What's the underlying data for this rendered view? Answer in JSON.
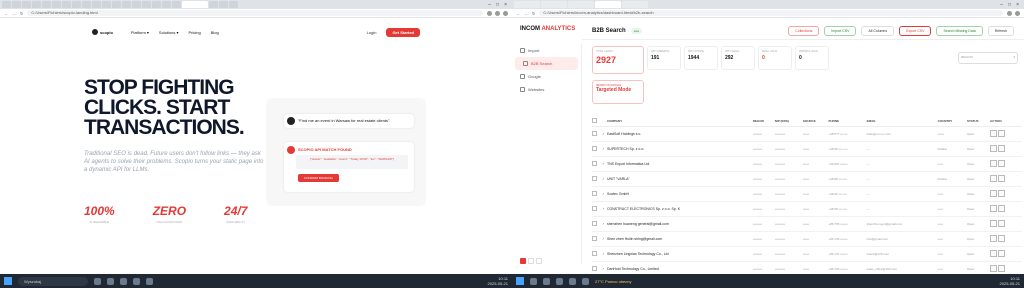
{
  "left": {
    "browser": {
      "url": "C:/Users/Fichiers/scopio-landing.html",
      "window_controls": [
        "–",
        "□",
        "×"
      ]
    },
    "nav": {
      "logo": "scopio",
      "items": [
        "Platform ▾",
        "Solutions ▾",
        "Pricing",
        "Blog"
      ],
      "login": "Login",
      "cta": "Get Started"
    },
    "hero": {
      "title_l1": "STOP FIGHTING",
      "title_l2": "CLICKS. START",
      "title_l3": "TRANSACTIONS.",
      "body": "Traditional SEO is dead. Future users don't follow links — they ask AI agents to solve their problems. Scopio turns your static page into a dynamic API for LLMs."
    },
    "stats": [
      {
        "value": "100%",
        "caption": "AI READABLE"
      },
      {
        "value": "ZERO",
        "caption": "HALLUCINATIONS"
      },
      {
        "value": "24/7",
        "caption": "AVAILABILITY"
      }
    ],
    "demo": {
      "question": "\"Find me an event in Warsaw for real estate clients\"",
      "answer_title": "SCOPIO API MATCH FOUND",
      "code": "{\"status\": \"available\", \"event\": \"Today 18:00\", \"loc\": \"WARSAW\"}",
      "button": "CONFIRM BOOKING"
    },
    "taskbar": {
      "search": "Wyszukaj",
      "time": "10:11",
      "date": "2025-05-21"
    }
  },
  "right": {
    "browser": {
      "url": "C:/Users/Fichiers/incom-analytics/dashboard.html#b2b-search"
    },
    "brand": {
      "name_a": "INCOM",
      "name_b": " ANALYTICS"
    },
    "sidebar": [
      "B2B Search",
      "Import",
      "Google",
      "Websites"
    ],
    "header": {
      "title": "B2B Search",
      "live": "Live",
      "collections": "Collections",
      "import_csv": "Import CSV",
      "columns": "All Columns",
      "export_csv": "Export CSV",
      "search_missing": "Search Missing Data",
      "refresh": "Refresh"
    },
    "cards": [
      {
        "label": "TOTAL LEADS",
        "value": "2927"
      },
      {
        "label": "WITH WEBSITE",
        "value": "191"
      },
      {
        "label": "WITH PHONE",
        "value": "1944"
      },
      {
        "label": "WITH EMAIL",
        "value": "292"
      },
      {
        "label": "EMAIL VALID",
        "value": "0"
      },
      {
        "label": "WEBSITE VALID",
        "value": "0"
      }
    ],
    "filter_label": "REGION",
    "extra_card": {
      "label": "SEARCH IN GOOGLE",
      "value": "Targeted Mode"
    },
    "table": {
      "headers": [
        "COMPANY",
        "REGON",
        "NIP (KRS)",
        "SOURCE",
        "PHONE",
        "EMAIL",
        "COUNTRY",
        "STATUS",
        "ACTION"
      ],
      "rows": [
        [
          "EastSoft Holdings s.c.",
          "•••••••••",
          "••••••••••",
          "••••••",
          "+48 577 ••• •••",
          "hello@••••••••.com",
          "••••••",
          "Open"
        ],
        [
          "SUPERTECH Sp. z o.o.",
          "•••••••••",
          "••••••••••",
          "••••••",
          "+48 68 ••• •• ••",
          "—",
          "Polska",
          "Open"
        ],
        [
          "TNS Export Informatica Ltd.",
          "•••••••••",
          "••••••••••",
          "••••••",
          "+39 067 •••••••",
          "—",
          "•••••",
          "Open"
        ],
        [
          "UNIT \"VARLA\"",
          "•••••••••",
          "••••••••••",
          "••••••",
          "+48 88 ••• ••••",
          "—",
          "Polska",
          "Open"
        ],
        [
          "Sootec GmbH",
          "•••••••••",
          "••••••••••",
          "••••••",
          "+48 66 ••• ••••",
          "—",
          "•••••",
          "Open"
        ],
        [
          "CONSTRUCT ELECTRONICS Sp. z o.o. Sp. K",
          "•••••••••",
          "••••••••••",
          "••••••",
          "+48 58 ••• ••••",
          "—",
          "•••••",
          "Open"
        ],
        [
          "shenzhen huaneng general@gmail.com",
          "•••••••••",
          "••••••••••",
          "••••••",
          "+86 755 •••••••",
          "shenzhen.gen@gmail.com",
          "•••••",
          "Open"
        ],
        [
          "Shen zhen Huilin shing@gmail.com",
          "•••••••••",
          "••••••••••",
          "••••••",
          "+86 135 •••••••",
          "info@gmail.com",
          "•••••",
          "Open"
        ],
        [
          "Shenzhen Lingxian Technology Co., Ltd",
          "•••••••••",
          "••••••••••",
          "••••••",
          "+86 137 •••••••",
          "lxtech@126.com",
          "•••••",
          "Open"
        ],
        [
          "DanHold Technology Co., Limited",
          "•••••••••",
          "••••••••••",
          "••••••",
          "+86 130 •••••••",
          "sales_office@163.com",
          "•••••",
          "Open"
        ]
      ]
    },
    "taskbar": {
      "alert": "27°C  Pomoc obecny",
      "time": "10:11",
      "date": "2025-05-21"
    }
  }
}
